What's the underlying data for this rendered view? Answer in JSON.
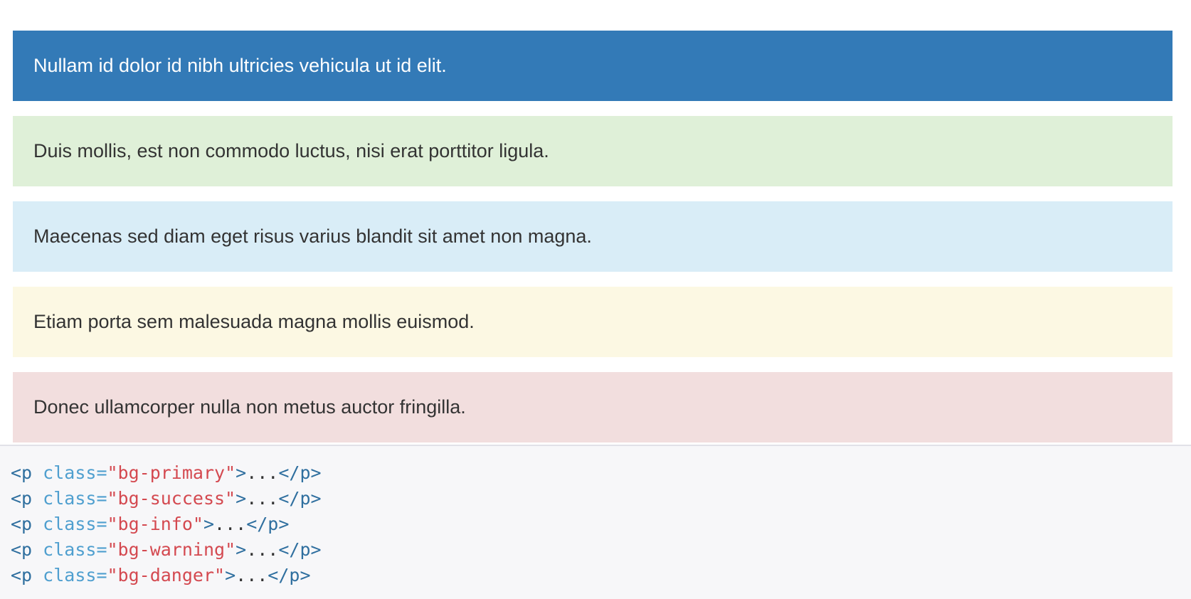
{
  "examples": [
    {
      "class": "bg-primary",
      "text": "Nullam id dolor id nibh ultricies vehicula ut id elit.",
      "color": "#337ab7"
    },
    {
      "class": "bg-success",
      "text": "Duis mollis, est non commodo luctus, nisi erat porttitor ligula.",
      "color": "#dff0d8"
    },
    {
      "class": "bg-info",
      "text": "Maecenas sed diam eget risus varius blandit sit amet non magna.",
      "color": "#d9edf7"
    },
    {
      "class": "bg-warning",
      "text": "Etiam porta sem malesuada magna mollis euismod.",
      "color": "#fcf8e3"
    },
    {
      "class": "bg-danger",
      "text": "Donec ullamcorper nulla non metus auctor fringilla.",
      "color": "#f2dede"
    }
  ],
  "code": [
    {
      "open": "<p",
      "attr": "class",
      "eq": "=",
      "value": "\"bg-primary\"",
      "close": ">",
      "content": "...",
      "end": "</p>"
    },
    {
      "open": "<p",
      "attr": "class",
      "eq": "=",
      "value": "\"bg-success\"",
      "close": ">",
      "content": "...",
      "end": "</p>"
    },
    {
      "open": "<p",
      "attr": "class",
      "eq": "=",
      "value": "\"bg-info\"",
      "close": ">",
      "content": "...",
      "end": "</p>"
    },
    {
      "open": "<p",
      "attr": "class",
      "eq": "=",
      "value": "\"bg-warning\"",
      "close": ">",
      "content": "...",
      "end": "</p>"
    },
    {
      "open": "<p",
      "attr": "class",
      "eq": "=",
      "value": "\"bg-danger\"",
      "close": ">",
      "content": "...",
      "end": "</p>"
    }
  ],
  "colors": {
    "code_tag": "#2f6f9f",
    "code_attr": "#4f9fcf",
    "code_string": "#d44950",
    "code_background": "#f7f7f9"
  }
}
